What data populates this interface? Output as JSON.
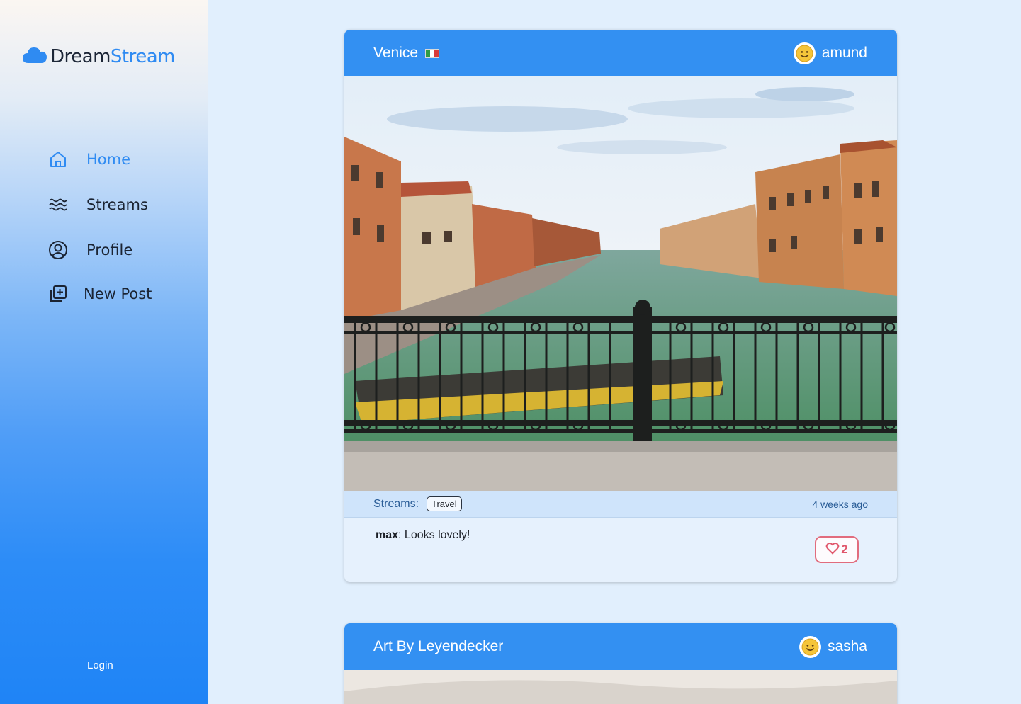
{
  "brand": {
    "part1": "Dream",
    "part2": "Stream"
  },
  "nav": {
    "home": "Home",
    "streams": "Streams",
    "profile": "Profile",
    "new_post": "New Post"
  },
  "login_label": "Login",
  "posts": [
    {
      "title": "Venice",
      "flag": "🇮🇹",
      "user": "amund",
      "streams_label": "Streams:",
      "tag": "Travel",
      "time_ago": "4 weeks ago",
      "comment_author": "max",
      "comment_text": ": Looks lovely!",
      "likes": "2"
    },
    {
      "title": "Art By Leyendecker",
      "user": "sasha"
    }
  ],
  "icons": {
    "logo": "cloud-icon",
    "home": "home-icon",
    "streams": "waves-icon",
    "profile": "user-circle-icon",
    "new_post": "add-square-icon",
    "avatar": "smiley-avatar",
    "like": "heart-icon"
  },
  "colors": {
    "accent": "#2f8bf2",
    "card_header": "#3390f2",
    "page_bg": "#e1effd",
    "like": "#e0566b"
  }
}
